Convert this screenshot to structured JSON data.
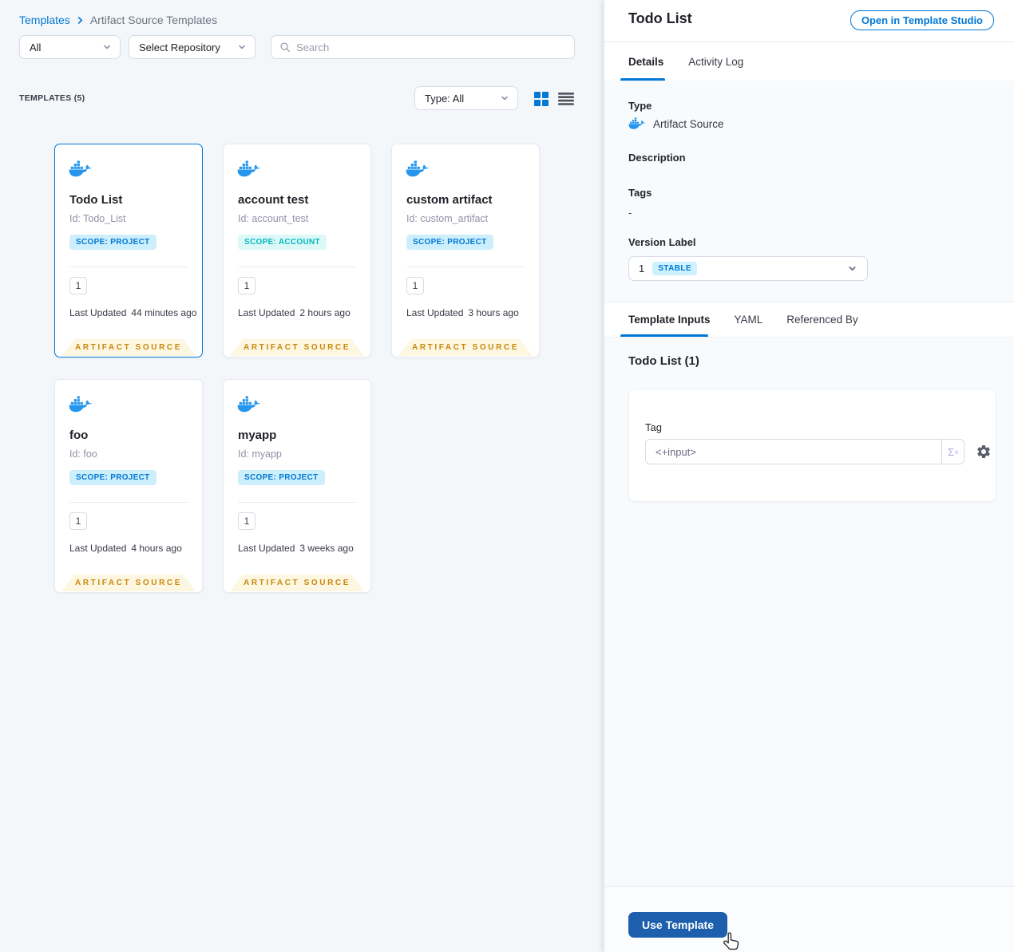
{
  "colors": {
    "accent": "#0278d5",
    "docker_blue": "#2496ed",
    "ribbon_bg": "#fdf6e0",
    "ribbon_text": "#c8890f",
    "badge_project_bg": "#cdeffc",
    "badge_project_text": "#0278d5",
    "badge_account_bg": "#dcf9f8",
    "badge_account_text": "#06b7c2",
    "stable_badge_bg": "#cdf2fe",
    "use_button_bg": "#1d5fad"
  },
  "breadcrumb": {
    "root": "Templates",
    "current": "Artifact Source Templates"
  },
  "filters": {
    "scope": "All",
    "repository": "Select Repository",
    "search_placeholder": "Search",
    "type": "Type: All"
  },
  "labels": {
    "templates_count": "TEMPLATES (5)",
    "last_updated": "Last Updated",
    "artifact_source": "ARTIFACT SOURCE"
  },
  "cards": [
    {
      "title": "Todo List",
      "id": "Id: Todo_List",
      "scope": "SCOPE: PROJECT",
      "version": "1",
      "updated": "44 minutes ago"
    },
    {
      "title": "account test",
      "id": "Id: account_test",
      "scope": "SCOPE: ACCOUNT",
      "version": "1",
      "updated": "2 hours ago"
    },
    {
      "title": "custom artifact",
      "id": "Id: custom_artifact",
      "scope": "SCOPE: PROJECT",
      "version": "1",
      "updated": "3 hours ago"
    },
    {
      "title": "foo",
      "id": "Id: foo",
      "scope": "SCOPE: PROJECT",
      "version": "1",
      "updated": "4 hours ago"
    },
    {
      "title": "myapp",
      "id": "Id: myapp",
      "scope": "SCOPE: PROJECT",
      "version": "1",
      "updated": "3 weeks ago"
    }
  ],
  "panel": {
    "title": "Todo List",
    "open_button": "Open in Template Studio",
    "tabs": {
      "details": "Details",
      "activity_log": "Activity Log"
    },
    "details": {
      "type_label": "Type",
      "type_value": "Artifact Source",
      "description_label": "Description",
      "tags_label": "Tags",
      "tags_value": "-",
      "version_label": "Version Label",
      "version_value": "1",
      "version_badge": "STABLE"
    },
    "sub_tabs": {
      "template_inputs": "Template Inputs",
      "yaml": "YAML",
      "referenced_by": "Referenced By"
    },
    "inputs": {
      "heading": "Todo List (1)",
      "tag_label": "Tag",
      "tag_value": "<+input>"
    },
    "use_button": "Use Template"
  },
  "icons": {
    "expression_sigma": "Σ",
    "expression_sup": "x"
  }
}
